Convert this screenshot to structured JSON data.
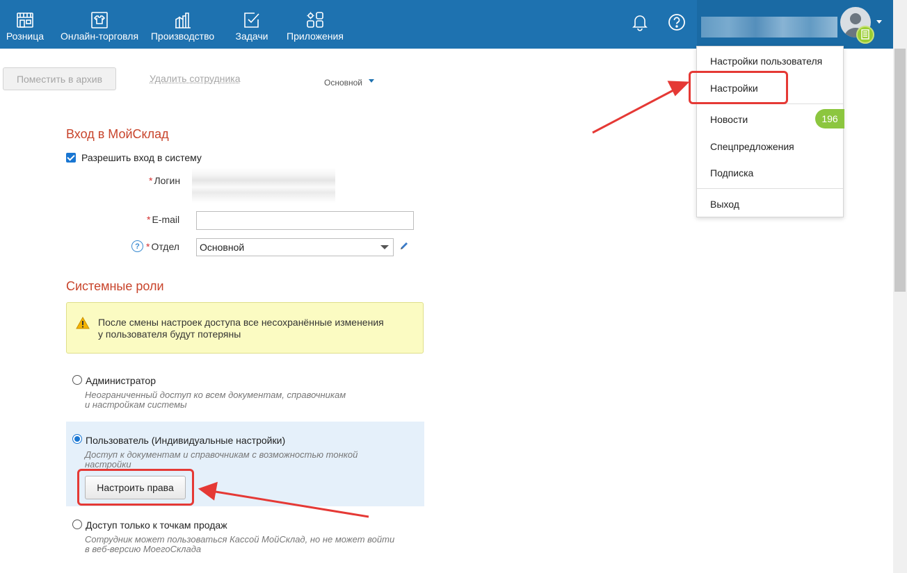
{
  "nav": {
    "items": [
      {
        "label": "Розница",
        "icon": "store-icon"
      },
      {
        "label": "Онлайн-торговля",
        "icon": "shirt-icon"
      },
      {
        "label": "Производство",
        "icon": "factory-icon"
      },
      {
        "label": "Задачи",
        "icon": "task-check-icon"
      },
      {
        "label": "Приложения",
        "icon": "apps-icon"
      }
    ]
  },
  "toolbar": {
    "archive_label": "Поместить в архив",
    "delete_label": "Удалить сотрудника",
    "dept_tab": "Основной"
  },
  "login_section": {
    "title": "Вход в МойСклад",
    "allow_login": "Разрешить вход в систему",
    "login_label": "Логин",
    "email_label": "E-mail",
    "email_value": "",
    "dept_label": "Отдел",
    "dept_value": "Основной",
    "help_glyph": "?"
  },
  "roles_section": {
    "title": "Системные роли",
    "warning_line1": "После смены настроек доступа все несохранённые изменения",
    "warning_line2": "у пользователя будут потеряны",
    "roles": [
      {
        "title": "Администратор",
        "desc1": "Неограниченный доступ ко всем документам, справочникам",
        "desc2": "и настройкам системы",
        "selected": false
      },
      {
        "title": "Пользователь (Индивидуальные настройки)",
        "desc1": "Доступ к документам и справочникам с возможностью тонкой",
        "desc2": "настройки",
        "selected": true
      },
      {
        "title": "Доступ только к точкам продаж",
        "desc1": "Сотрудник может пользоваться Кассой МойСклад, но не может войти",
        "desc2": "в веб-версию МоегоСклада",
        "selected": false
      }
    ],
    "configure_rights_label": "Настроить права"
  },
  "user_menu": {
    "items": [
      "Настройки пользователя",
      "Настройки",
      "Новости",
      "Спецпредложения",
      "Подписка",
      "Выход"
    ],
    "news_badge": "196"
  },
  "colors": {
    "topbar": "#1e72b0",
    "section_title": "#c8442b",
    "highlight": "#e53935",
    "badge": "#8cc63f"
  }
}
